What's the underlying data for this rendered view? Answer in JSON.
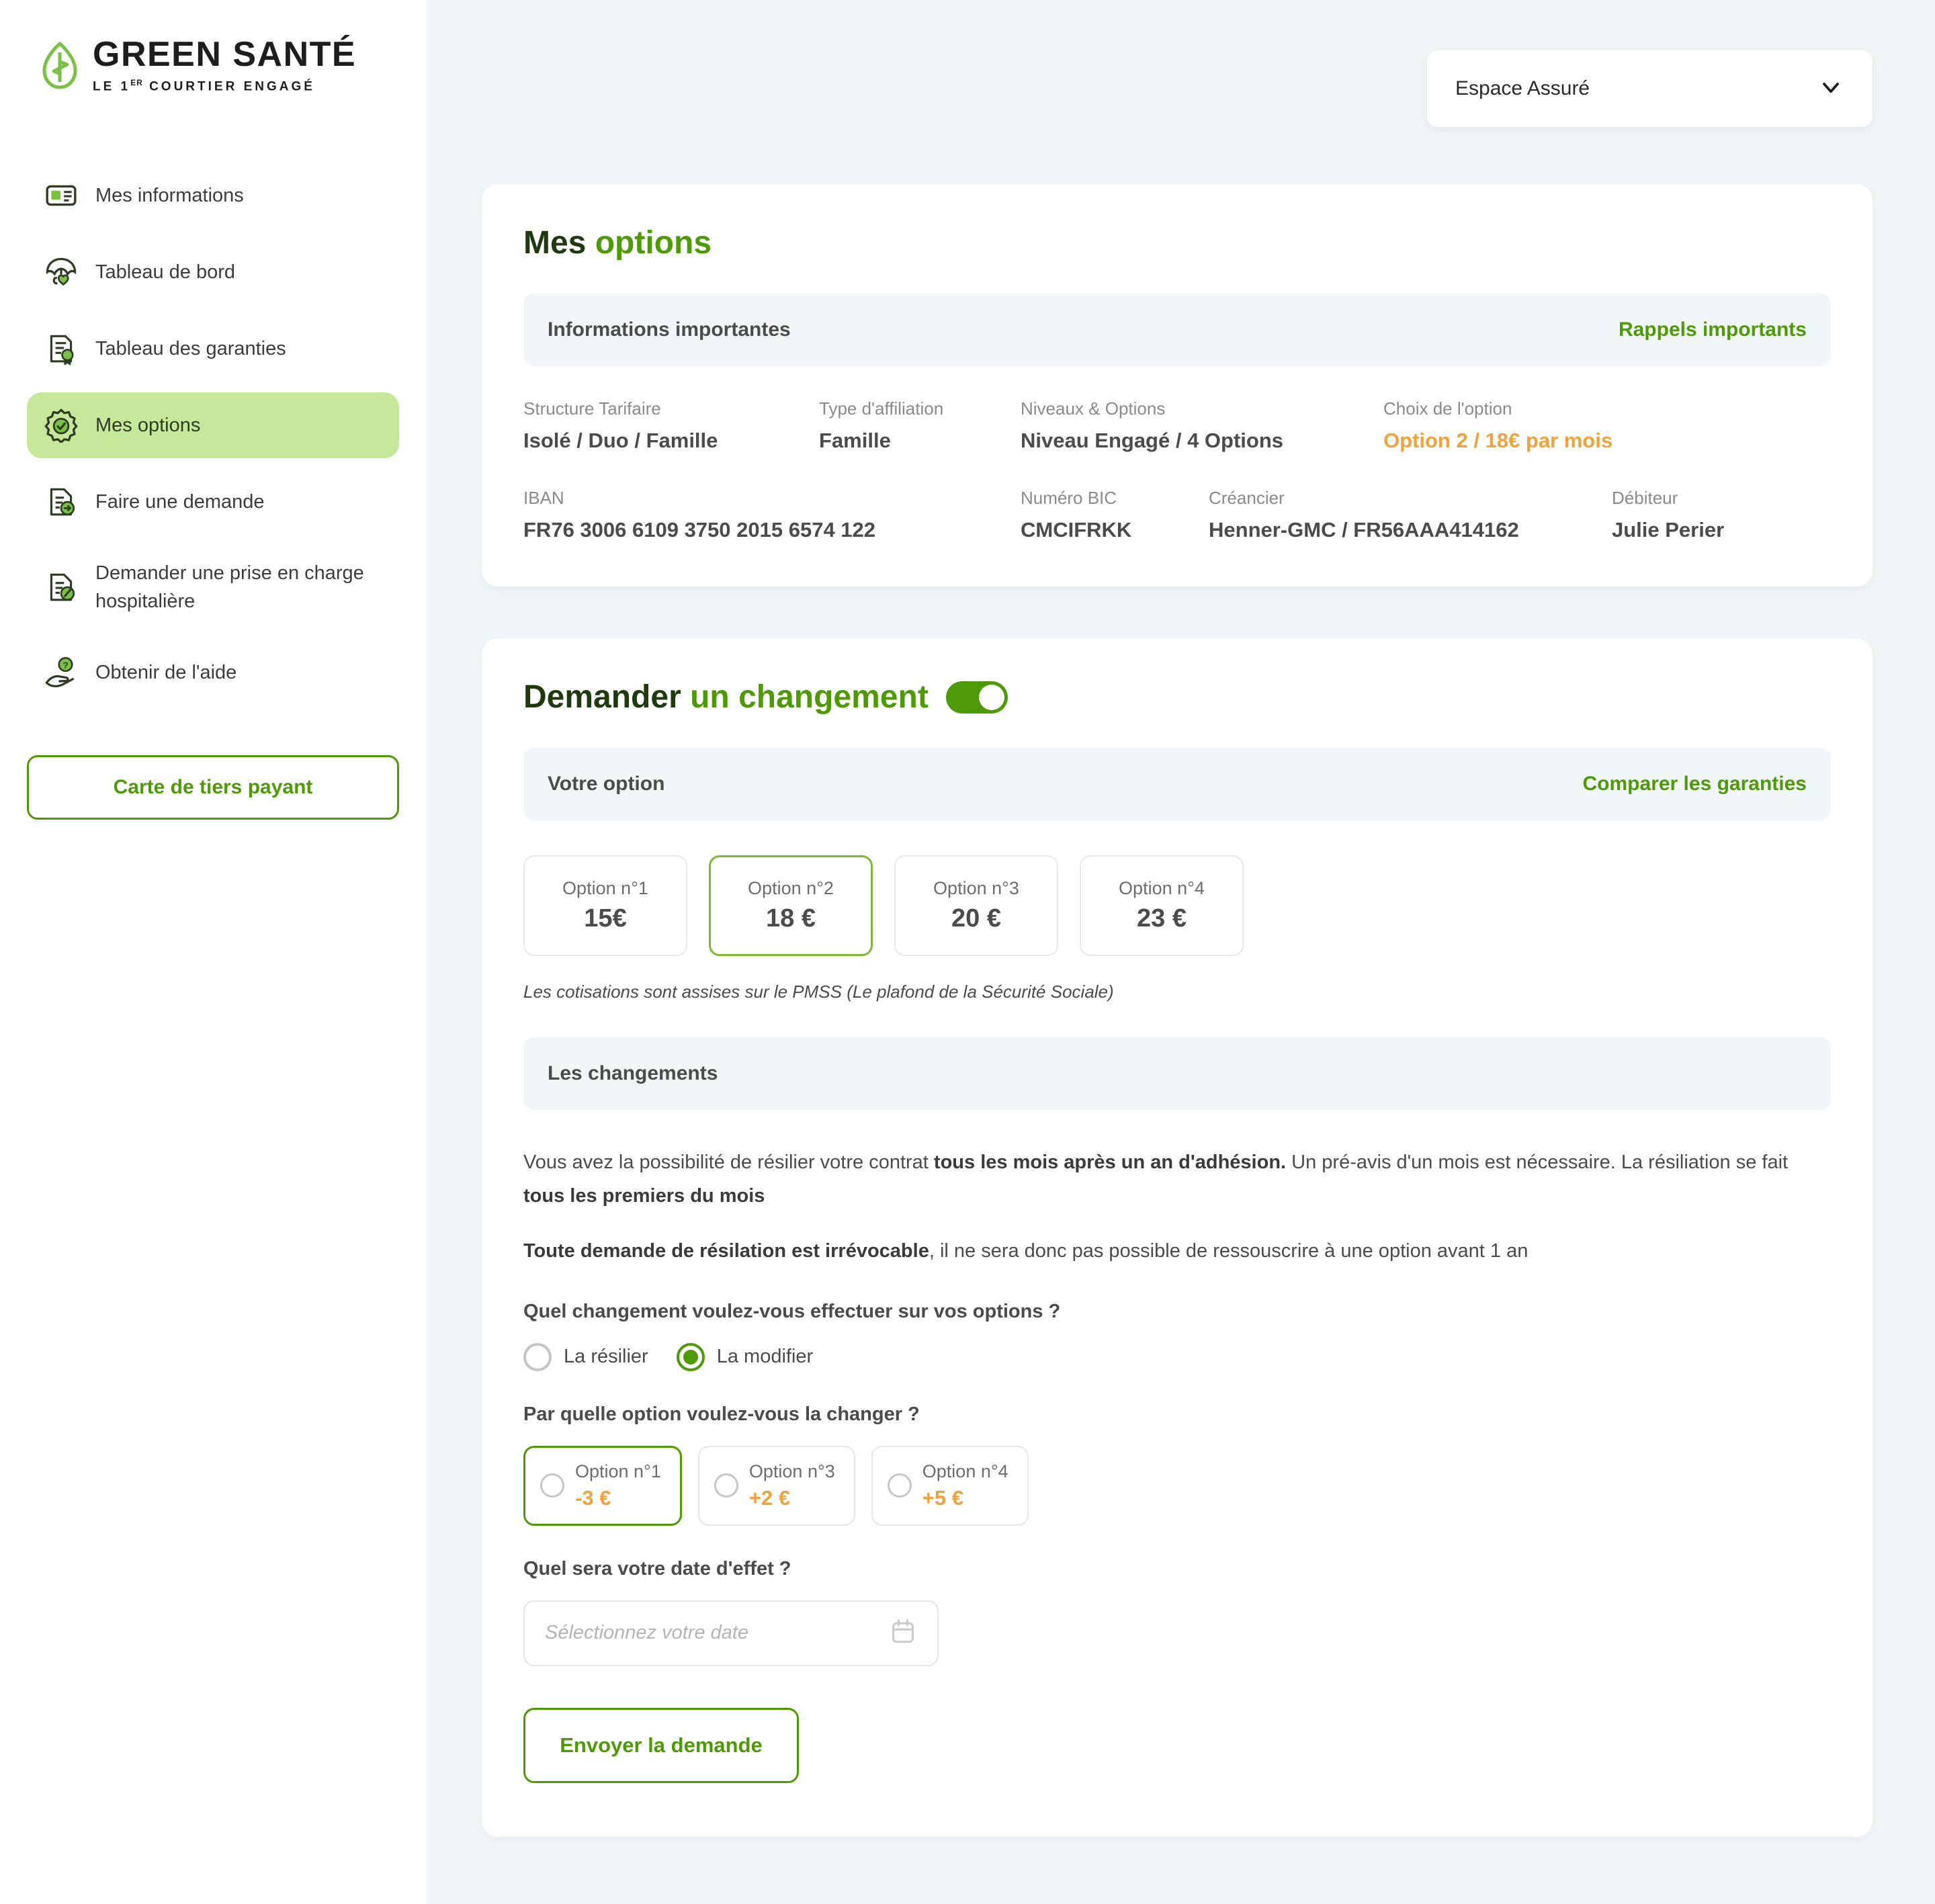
{
  "brand": {
    "title": "GREEN SANTÉ",
    "subtitle_pre": "LE 1",
    "subtitle_sup": "ER",
    "subtitle_post": " COURTIER ENGAGÉ",
    "leaf_color": "#7ac143",
    "accent_green": "#4e9a06",
    "accent_orange": "#f0a33c",
    "active_bg": "#c5e89b"
  },
  "sidebar": {
    "items": [
      {
        "label": "Mes informations",
        "icon": "id-card-icon",
        "active": false
      },
      {
        "label": "Tableau de bord",
        "icon": "umbrella-heart-icon",
        "active": false
      },
      {
        "label": "Tableau des garanties",
        "icon": "document-seal-icon",
        "active": false
      },
      {
        "label": "Mes options",
        "icon": "badge-check-icon",
        "active": true
      },
      {
        "label": "Faire une demande",
        "icon": "document-arrow-icon",
        "active": false
      },
      {
        "label": "Demander une prise en charge hospitalière",
        "icon": "document-pencil-icon",
        "active": false
      },
      {
        "label": "Obtenir de l'aide",
        "icon": "hand-question-icon",
        "active": false
      }
    ],
    "tiers_payant_button": "Carte de tiers payant"
  },
  "topbar": {
    "space_select_value": "Espace Assuré",
    "chevron_icon": "chevron-down-icon"
  },
  "options_card": {
    "title_dark": "Mes ",
    "title_green": "options",
    "band_label": "Informations importantes",
    "band_link": "Rappels importants",
    "rows": [
      [
        {
          "key": "Structure Tarifaire",
          "value": "Isolé / Duo / Famille",
          "accent": false
        },
        {
          "key": "Type d'affiliation",
          "value": "Famille",
          "accent": false
        },
        {
          "key": "Niveaux & Options",
          "value": "Niveau Engagé / 4 Options",
          "accent": false
        },
        {
          "key": "Choix de l'option",
          "value": "Option 2 / 18€ par mois",
          "accent": true
        }
      ],
      [
        {
          "key": "IBAN",
          "value": "FR76 3006 6109 3750 2015 6574 122",
          "accent": false
        },
        {
          "key": "Numéro BIC",
          "value": "CMCIFRKK",
          "accent": false
        },
        {
          "key": "Créancier",
          "value": "Henner-GMC / FR56AAA414162",
          "accent": false
        },
        {
          "key": "Débiteur",
          "value": "Julie Perier",
          "accent": false
        }
      ]
    ]
  },
  "change_card": {
    "title_dark": "Demander ",
    "title_green": "un changement",
    "toggle_on": true,
    "band_label": "Votre option",
    "band_link": "Comparer les garanties",
    "options": [
      {
        "name": "Option n°1",
        "price": "15€",
        "selected": false
      },
      {
        "name": "Option n°2",
        "price": "18 €",
        "selected": true
      },
      {
        "name": "Option n°3",
        "price": "20 €",
        "selected": false
      },
      {
        "name": "Option n°4",
        "price": "23 €",
        "selected": false
      }
    ],
    "pmss_note": "Les cotisations sont assises sur le PMSS (Le plafond de la Sécurité Sociale)",
    "changes_band_label": "Les changements",
    "para1_a": "Vous avez la possibilité de résilier votre contrat ",
    "para1_b": "tous les mois après un an d'adhésion.",
    "para1_c": " Un pré-avis d'un mois est nécessaire. La résiliation se fait ",
    "para1_d": "tous les premiers du mois",
    "para2_a": "Toute demande de résilation est irrévocable",
    "para2_b": ", il ne sera donc pas possible de ressouscrire à une option avant 1 an",
    "q_change": "Quel changement voulez-vous effectuer sur vos options ?",
    "radio_resilier": "La résilier",
    "radio_modifier": "La modifier",
    "q_which_option": "Par quelle option voulez-vous la changer ?",
    "change_options": [
      {
        "name": "Option n°1",
        "delta": "-3 €",
        "selected": true
      },
      {
        "name": "Option n°3",
        "delta": "+2 €",
        "selected": false
      },
      {
        "name": "Option n°4",
        "delta": "+5 €",
        "selected": false
      }
    ],
    "q_date": "Quel sera votre date d'effet ?",
    "date_placeholder": "Sélectionnez votre date",
    "date_value": "",
    "calendar_icon": "calendar-icon",
    "submit_label": "Envoyer la demande"
  }
}
